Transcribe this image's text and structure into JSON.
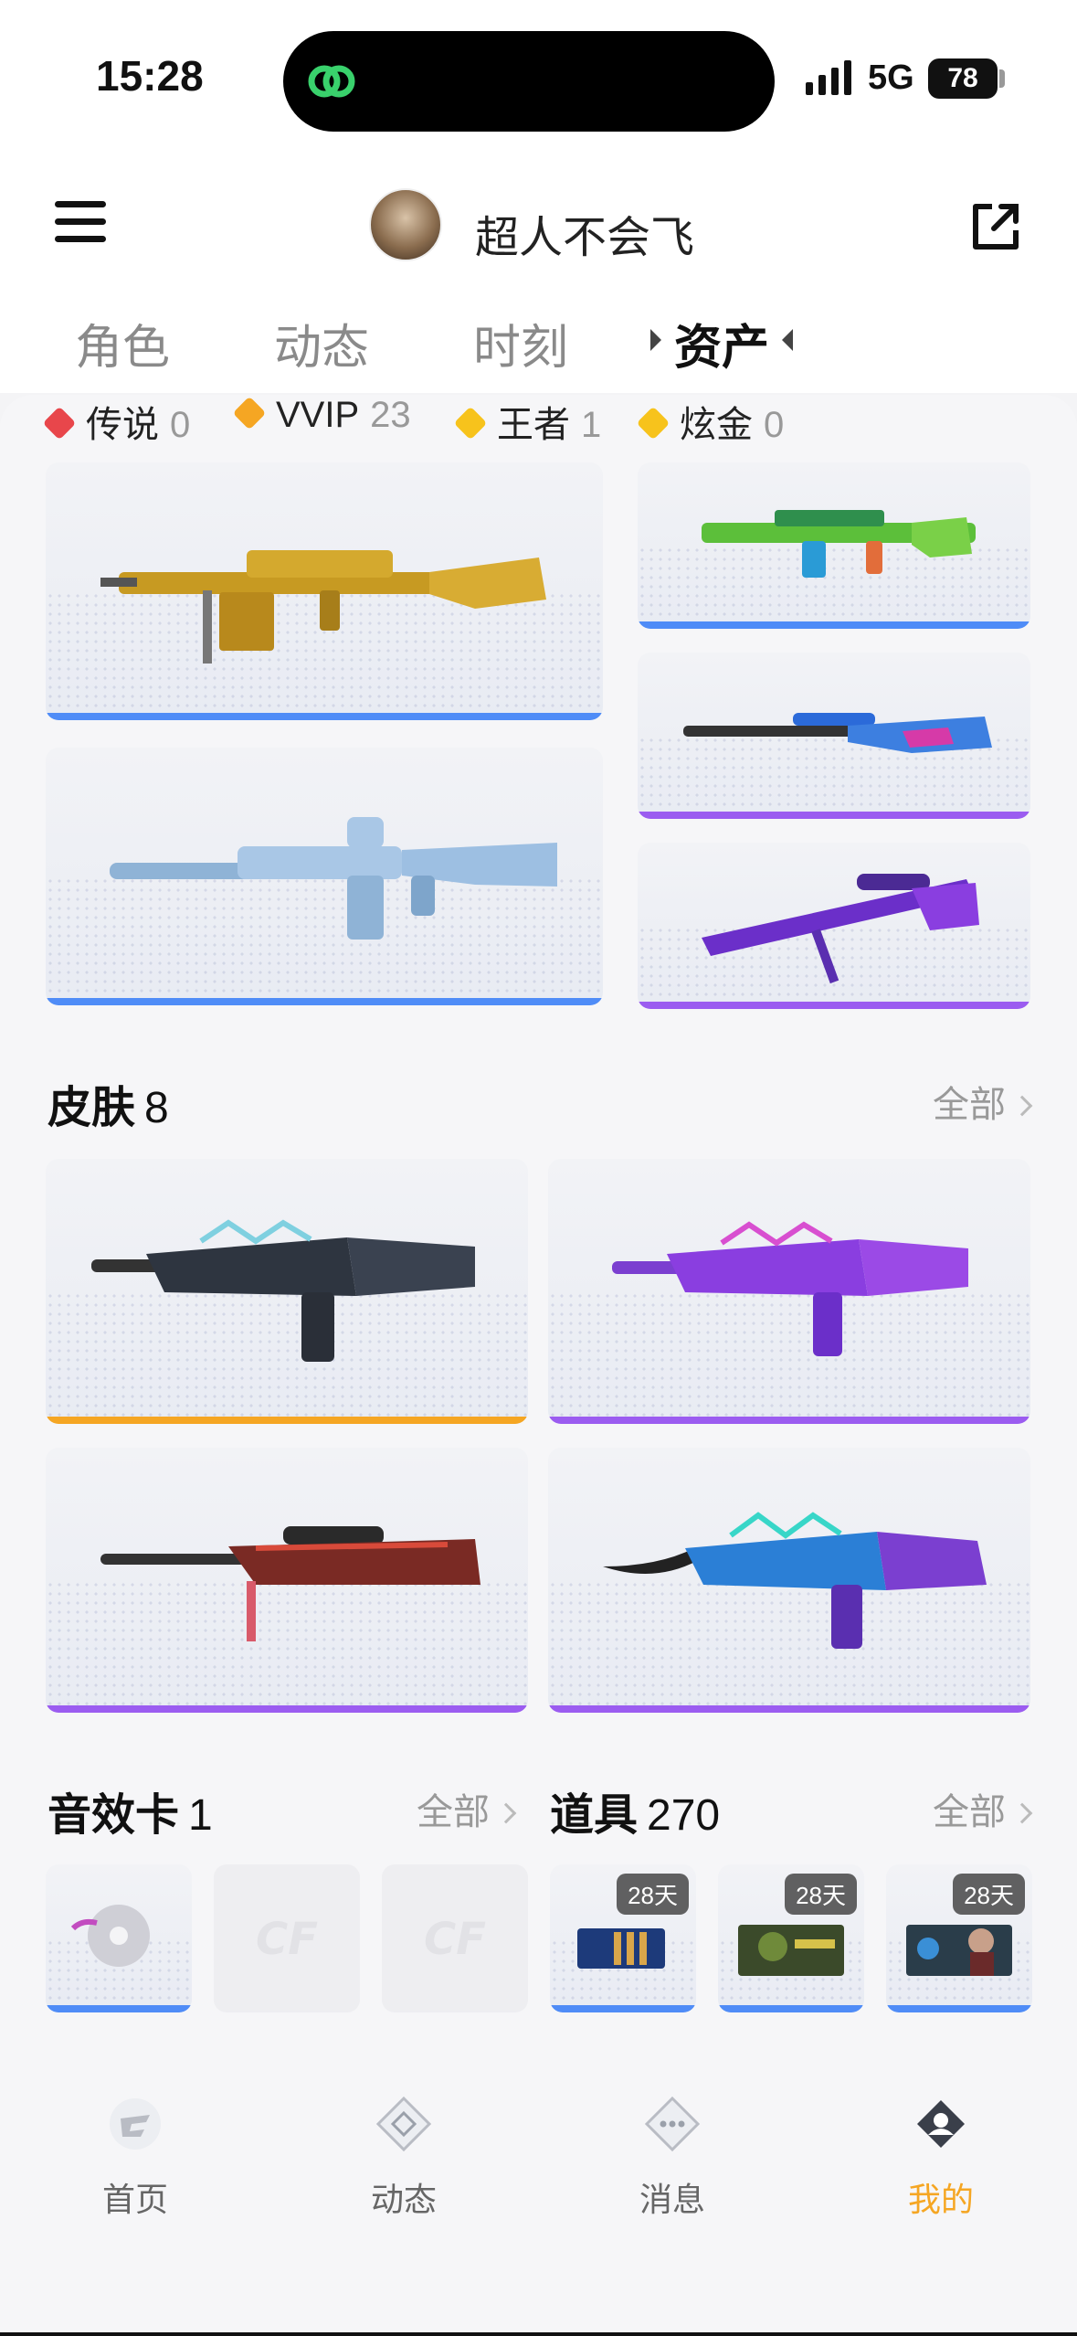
{
  "status_bar": {
    "time": "15:28",
    "network": "5G",
    "battery": "78"
  },
  "header": {
    "username": "超人不会飞"
  },
  "tabs": [
    {
      "label": "角色",
      "active": false
    },
    {
      "label": "动态",
      "active": false
    },
    {
      "label": "时刻",
      "active": false
    },
    {
      "label": "资产",
      "active": true
    }
  ],
  "rarity_badges": [
    {
      "label": "传说",
      "count": "0",
      "color": "#e8464b"
    },
    {
      "label": "VVIP",
      "count": "23",
      "color": "#f5a623"
    },
    {
      "label": "王者",
      "count": "1",
      "color": "#f7c31c"
    },
    {
      "label": "炫金",
      "count": "0",
      "color": "#f7c31c"
    }
  ],
  "weapons": [
    {
      "name": "golden-machine-gun",
      "bar_color": "#4f8cf7"
    },
    {
      "name": "green-camo-rifle",
      "bar_color": "#4f8cf7"
    },
    {
      "name": "blue-rifle",
      "bar_color": "#4f8cf7"
    },
    {
      "name": "dragon-sniper",
      "bar_color": "#9b5cf0"
    },
    {
      "name": "purple-sniper",
      "bar_color": "#9b5cf0"
    }
  ],
  "skins": {
    "title": "皮肤",
    "count": "8",
    "more_label": "全部",
    "items": [
      {
        "name": "shark-rifle-dark",
        "bar_color": "#f5a623"
      },
      {
        "name": "shark-rifle-purple",
        "bar_color": "#9b5cf0"
      },
      {
        "name": "red-sniper",
        "bar_color": "#9b5cf0"
      },
      {
        "name": "shark-rifle-neon",
        "bar_color": "#9b5cf0"
      }
    ]
  },
  "sound_cards": {
    "title": "音效卡",
    "count": "1",
    "more_label": "全部"
  },
  "props": {
    "title": "道具",
    "count": "270",
    "more_label": "全部",
    "items": [
      {
        "days": "28天"
      },
      {
        "days": "28天"
      },
      {
        "days": "28天"
      }
    ]
  },
  "nav": [
    {
      "label": "首页",
      "icon": "home-icon",
      "active": false
    },
    {
      "label": "动态",
      "icon": "feed-icon",
      "active": false
    },
    {
      "label": "消息",
      "icon": "message-icon",
      "active": false
    },
    {
      "label": "我的",
      "icon": "profile-icon",
      "active": true
    }
  ]
}
